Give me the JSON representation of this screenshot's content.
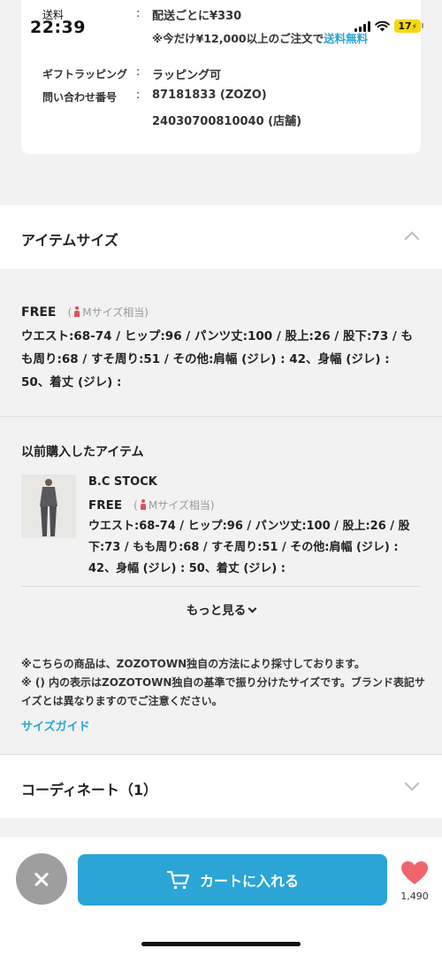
{
  "status_bar": {
    "back_label": "送料",
    "time": "22:39",
    "battery": "17"
  },
  "shipping": {
    "label": "送料",
    "value": "配送ごとに¥330",
    "note_prefix": "※今だけ¥12,000以上のご注文で",
    "note_link": "送料無料"
  },
  "gift": {
    "label": "ギフトラッピング",
    "value": "ラッピング可"
  },
  "inquiry": {
    "label": "問い合わせ番号",
    "value1": "87181833 (ZOZO)",
    "value2": "24030700810040 (店舗)"
  },
  "item_size": {
    "title": "アイテムサイズ",
    "size_name": "FREE",
    "size_equiv_prefix": "(",
    "size_equiv": "Mサイズ相当)",
    "detail": "ウエスト:68-74 / ヒップ:96 / パンツ丈:100 / 股上:26 / 股下:73 / もも周り:68 / すそ周り:51 / その他:肩幅 (ジレ) : 42、身幅 (ジレ) : 50、着丈 (ジレ) :"
  },
  "previous": {
    "title": "以前購入したアイテム",
    "brand": "B.C STOCK",
    "size_name": "FREE",
    "size_equiv_prefix": "(",
    "size_equiv": "Mサイズ相当)",
    "detail": "ウエスト:68-74 / ヒップ:96 / パンツ丈:100 / 股上:26 / 股下:73 / もも周り:68 / すそ周り:51 / その他:肩幅 (ジレ) : 42、身幅 (ジレ) : 50、着丈 (ジレ) :",
    "more_label": "もっと見る"
  },
  "notes": {
    "line1": "※こちらの商品は、ZOZOTOWN独自の方法により採寸しております。",
    "line2": "※ () 内の表示はZOZOTOWN独自の基準で振り分けたサイズです。ブランド表記サイズとは異なりますのでご注意ください。",
    "size_guide": "サイズガイド"
  },
  "coordinate": {
    "title": "コーディネート（1）"
  },
  "bottom": {
    "cart_label": "カートに入れる",
    "fav_count": "1,490"
  },
  "colors": {
    "accent": "#2aa5d6",
    "heart": "#f0646e",
    "close_bg": "#9e9e9e"
  }
}
